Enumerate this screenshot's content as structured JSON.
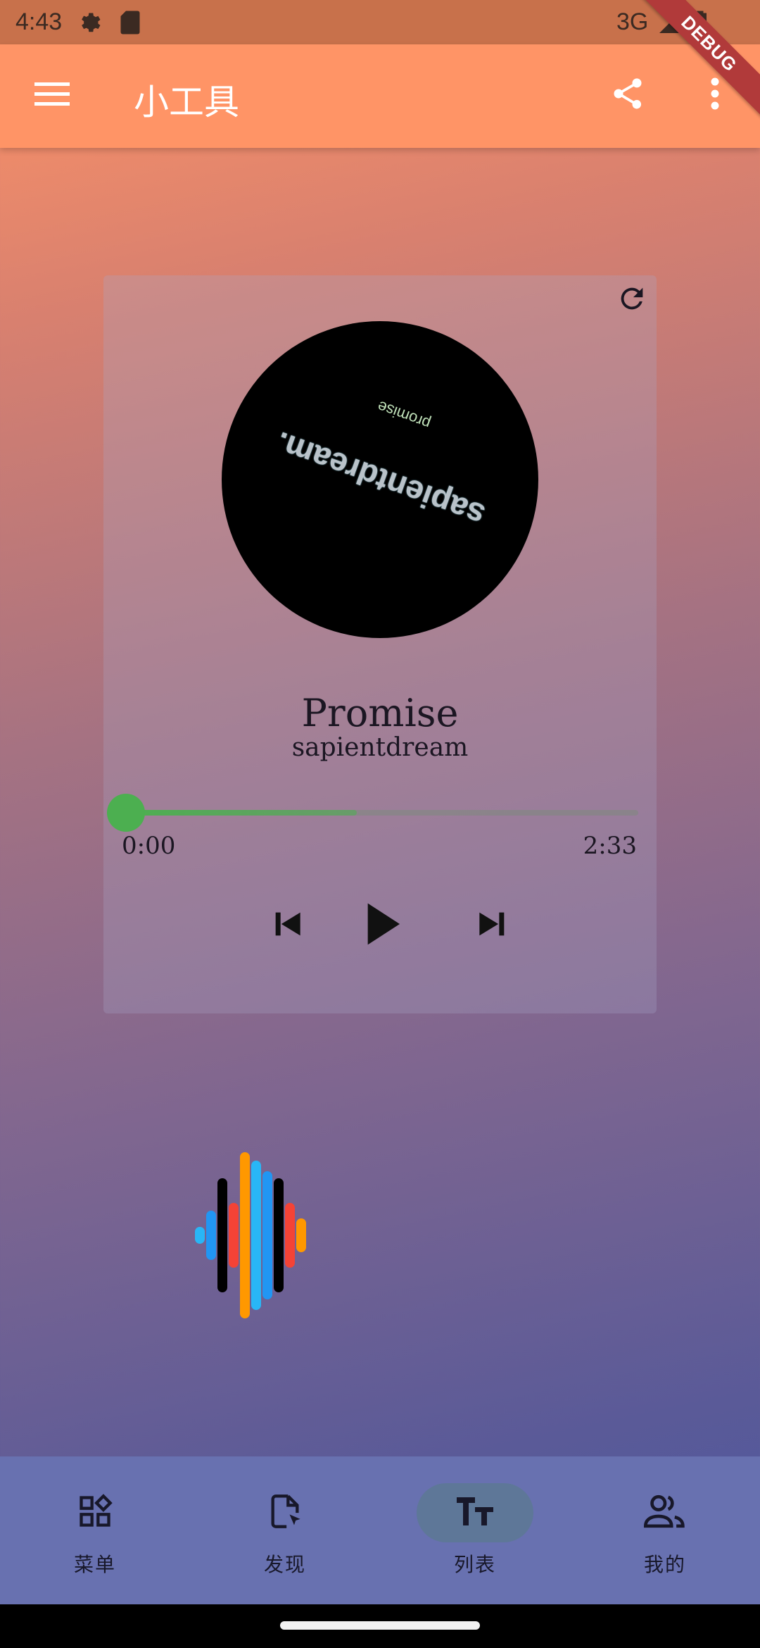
{
  "status_bar": {
    "time": "4:43",
    "network": "3G",
    "icons": [
      "settings-icon",
      "sd-card-icon",
      "signal-icon",
      "battery-icon"
    ]
  },
  "app_bar": {
    "title": "小工具",
    "menu_icon": "menu-icon",
    "share_icon": "share-icon",
    "more_icon": "more-vert-icon"
  },
  "debug_banner": "DEBUG",
  "player": {
    "album_text_main": "sapientdream.",
    "album_text_small": "promise",
    "title": "Promise",
    "artist": "sapientdream",
    "position": "0:00",
    "duration": "2:33",
    "progress": 0.45,
    "refresh_icon": "refresh-icon",
    "controls": [
      "skip-previous-icon",
      "play-icon",
      "skip-next-icon"
    ]
  },
  "visualizer": {
    "colors": {
      "blue": "#2196f3",
      "light_blue": "#29b6f6",
      "black": "#000000",
      "red": "#f44336",
      "orange": "#ff9800"
    },
    "bars": [
      {
        "color": "light_blue",
        "level": 0.1
      },
      {
        "color": "blue",
        "level": 0.3
      },
      {
        "color": "black",
        "level": 0.69
      },
      {
        "color": "red",
        "level": 0.39
      },
      {
        "color": "orange",
        "level": 1.0
      },
      {
        "color": "light_blue",
        "level": 0.9
      },
      {
        "color": "blue",
        "level": 0.77
      },
      {
        "color": "black",
        "level": 0.69
      },
      {
        "color": "red",
        "level": 0.39
      },
      {
        "color": "orange",
        "level": 0.2
      }
    ]
  },
  "bottom_nav": {
    "items": [
      {
        "label": "菜单",
        "icon": "widgets-icon",
        "active": false
      },
      {
        "label": "发现",
        "icon": "file-cursor-icon",
        "active": false
      },
      {
        "label": "列表",
        "icon": "text-fields-icon",
        "active": true
      },
      {
        "label": "我的",
        "icon": "people-icon",
        "active": false
      }
    ]
  },
  "theme": {
    "app_bar": "#ff9466",
    "status_bar": "#c8714b",
    "nav_bar": "#6871b0",
    "nav_active_pill": "#5e7798",
    "progress": "#4caf50"
  }
}
